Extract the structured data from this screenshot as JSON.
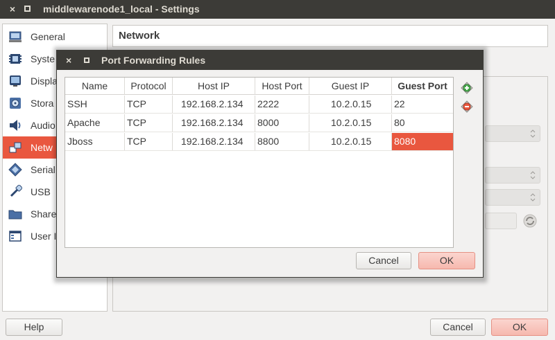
{
  "window": {
    "title": "middlewarenode1_local - Settings",
    "close_glyph": "×"
  },
  "sidebar": {
    "items": [
      {
        "label": "General",
        "icon": "general-icon"
      },
      {
        "label": "Syste",
        "icon": "system-icon"
      },
      {
        "label": "Displa",
        "icon": "display-icon"
      },
      {
        "label": "Stora",
        "icon": "storage-icon"
      },
      {
        "label": "Audio",
        "icon": "audio-icon"
      },
      {
        "label": "Netw",
        "icon": "network-icon",
        "selected": true
      },
      {
        "label": "Serial",
        "icon": "serial-icon"
      },
      {
        "label": "USB",
        "icon": "usb-icon"
      },
      {
        "label": "Share",
        "icon": "shared-folders-icon"
      },
      {
        "label": "User I",
        "icon": "user-interface-icon"
      }
    ]
  },
  "section": {
    "title": "Network"
  },
  "footer": {
    "help_label": "Help",
    "cancel_label": "Cancel",
    "ok_label": "OK"
  },
  "dialog": {
    "title": "Port Forwarding Rules",
    "close_glyph": "×",
    "columns": [
      "Name",
      "Protocol",
      "Host IP",
      "Host Port",
      "Guest IP",
      "Guest Port"
    ],
    "rows": [
      [
        "SSH",
        "TCP",
        "192.168.2.134",
        "2222",
        "10.2.0.15",
        "22"
      ],
      [
        "Apache",
        "TCP",
        "192.168.2.134",
        "8000",
        "10.2.0.15",
        "80"
      ],
      [
        "Jboss",
        "TCP",
        "192.168.2.134",
        "8800",
        "10.2.0.15",
        "8080"
      ]
    ],
    "editing_cell": "Jboss Guest Port",
    "cancel_label": "Cancel",
    "ok_label": "OK",
    "add_rule_icon": "add-rule-icon",
    "remove_rule_icon": "remove-rule-icon"
  },
  "colors": {
    "titlebar": "#3c3b37",
    "accent": "#e9573f",
    "ok_button": "#f6b8ae"
  }
}
